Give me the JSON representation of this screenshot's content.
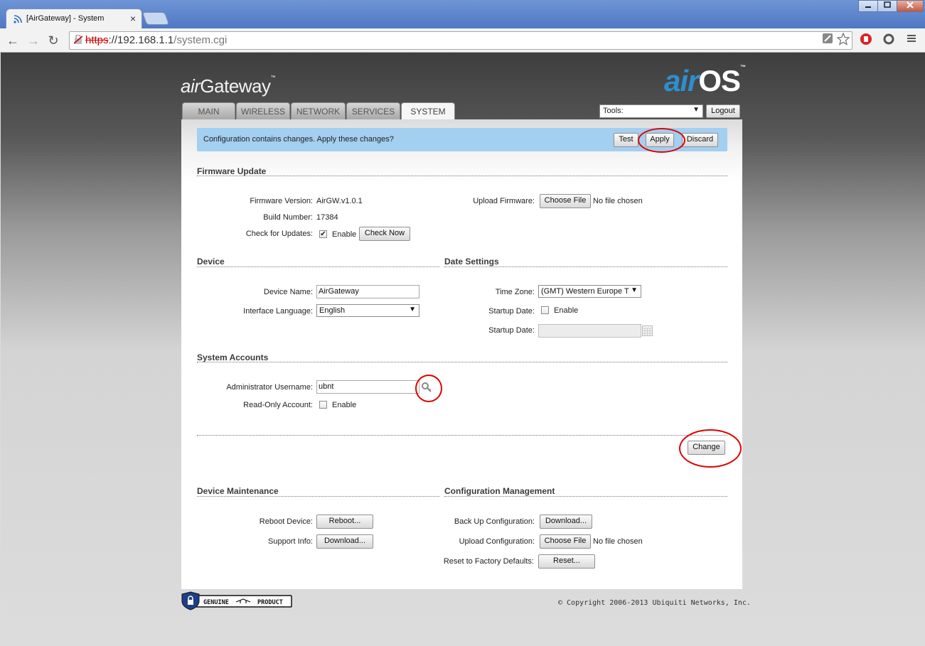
{
  "browser": {
    "tab_title": "[AirGateway] - System",
    "close_glyph": "×",
    "url_scheme": "https",
    "url_host": "://192.168.1.1",
    "url_path": "/system.cgi",
    "back": "←",
    "forward": "→",
    "reload": "↻"
  },
  "brand": {
    "air": "air",
    "gateway": "Gateway",
    "tm": "™",
    "os_air": "air",
    "os": "OS",
    "os_tm": "™"
  },
  "nav": {
    "tabs": [
      "MAIN",
      "WIRELESS",
      "NETWORK",
      "SERVICES",
      "SYSTEM"
    ],
    "active": "SYSTEM"
  },
  "tools": {
    "label": "Tools:",
    "logout": "Logout"
  },
  "notice": {
    "message": "Configuration contains changes. Apply these changes?",
    "test": "Test",
    "apply": "Apply",
    "discard": "Discard"
  },
  "firmware": {
    "title": "Firmware Update",
    "version_label": "Firmware Version:",
    "version": "AirGW.v1.0.1",
    "build_label": "Build Number:",
    "build": "17384",
    "check_label": "Check for Updates:",
    "check_enabled": true,
    "enable": "Enable",
    "check_now": "Check Now",
    "upload_label": "Upload Firmware:",
    "choose_file": "Choose File",
    "no_file": "No file chosen"
  },
  "device": {
    "title": "Device",
    "name_label": "Device Name:",
    "name": "AirGateway",
    "lang_label": "Interface Language:",
    "lang": "English"
  },
  "date": {
    "title": "Date Settings",
    "tz_label": "Time Zone:",
    "tz": "(GMT) Western Europe T",
    "startup_label": "Startup Date:",
    "startup_enabled": false,
    "enable": "Enable",
    "startup_label2": "Startup Date:",
    "startup_value": ""
  },
  "accounts": {
    "title": "System Accounts",
    "admin_label": "Administrator Username:",
    "admin": "ubnt",
    "readonly_label": "Read-Only Account:",
    "readonly_enabled": false,
    "enable": "Enable",
    "change": "Change"
  },
  "maintenance": {
    "title": "Device Maintenance",
    "reboot_label": "Reboot Device:",
    "reboot": "Reboot...",
    "support_label": "Support Info:",
    "download": "Download..."
  },
  "config": {
    "title": "Configuration Management",
    "backup_label": "Back Up Configuration:",
    "download": "Download...",
    "upload_label": "Upload Configuration:",
    "choose_file": "Choose File",
    "no_file": "No file chosen",
    "reset_label": "Reset to Factory Defaults:",
    "reset": "Reset..."
  },
  "footer": {
    "genuine": "GENUINE",
    "product": "PRODUCT",
    "copyright": "© Copyright 2006-2013 Ubiquiti Networks, Inc."
  },
  "colors": {
    "annotation": "#e00000",
    "notice_bg": "#a3cff0",
    "brand_blue": "#2d8fd0"
  }
}
